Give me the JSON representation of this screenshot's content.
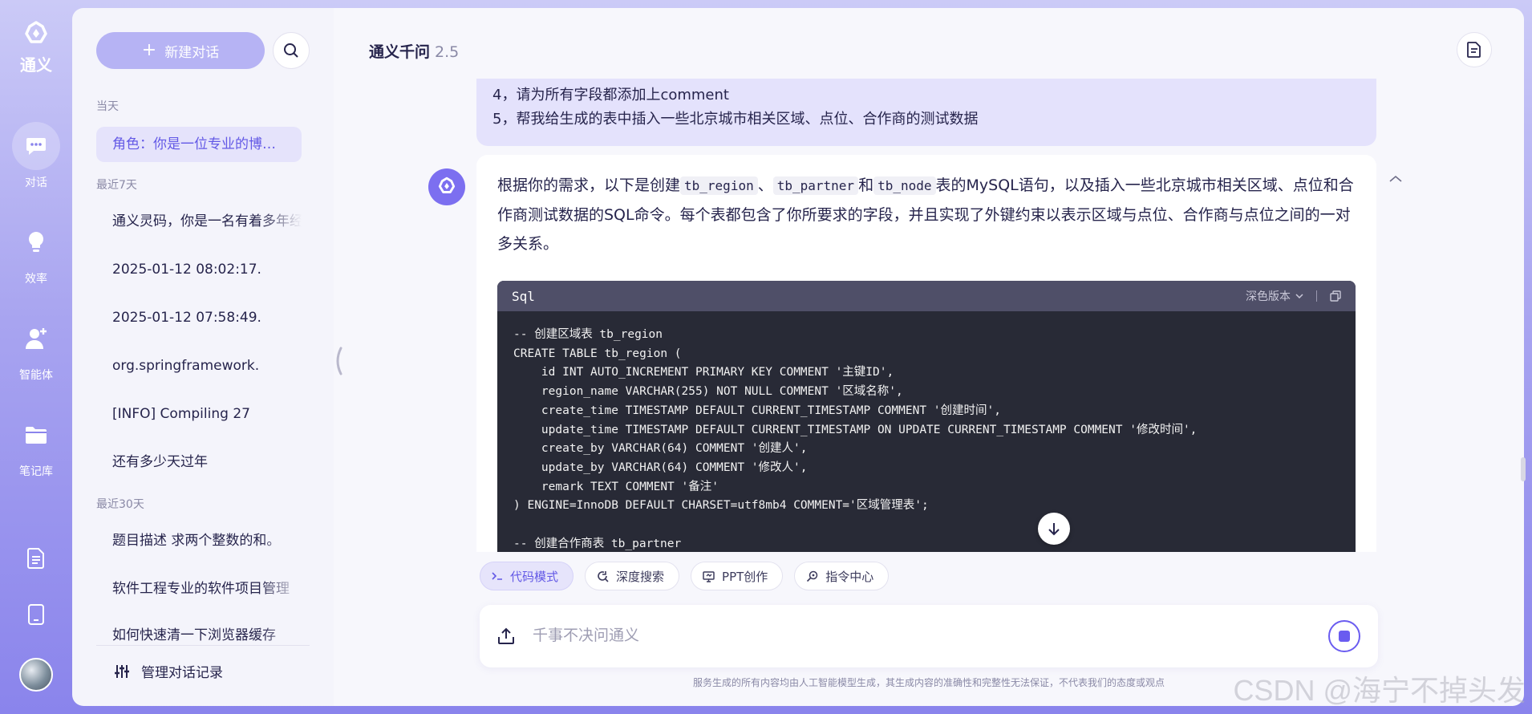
{
  "app": {
    "name": "通义"
  },
  "rail": {
    "items": [
      {
        "label": "对话",
        "icon": "chat-icon",
        "active": true
      },
      {
        "label": "效率",
        "icon": "lightbulb-icon"
      },
      {
        "label": "智能体",
        "icon": "agent-icon"
      },
      {
        "label": "笔记库",
        "icon": "folder-icon"
      }
    ]
  },
  "sidebar": {
    "new_chat_label": "新建对话",
    "sections": {
      "today": "当天",
      "week": "最近7天",
      "month": "最近30天"
    },
    "today_items": [
      "角色：你是一位专业的博客技术专家"
    ],
    "week_items": [
      "通义灵码，你是一名有着多年经验",
      "2025-01-12 08:02:17.",
      "2025-01-12 07:58:49.",
      "org.springframework.",
      "[INFO] Compiling 27",
      "还有多少天过年"
    ],
    "month_items": [
      "题目描述 求两个整数的和。",
      "软件工程专业的软件项目管理",
      "如何快速清一下浏览器缓存"
    ],
    "manage_label": "管理对话记录"
  },
  "header": {
    "title": "通义千问",
    "version": "2.5"
  },
  "user_message": {
    "lines": [
      "4，请为所有字段都添加上comment",
      "5，帮我给生成的表中插入一些北京城市相关区域、点位、合作商的测试数据"
    ]
  },
  "bot_message": {
    "p1": "根据你的需求，以下是创建",
    "code1": "tb_region",
    "p2": "、",
    "code2": "tb_partner",
    "p3": "和",
    "code3": "tb_node",
    "p4": "表的MySQL语句，以及插入一些北京城市相关区域、点位和合作商测试数据的SQL命令。每个表都包含了你所要求的字段，并且实现了外键约束以表示区域与点位、合作商与点位之间的一对多关系。"
  },
  "code_block": {
    "language": "Sql",
    "theme_label": "深色版本",
    "lines": [
      "-- 创建区域表 tb_region",
      "CREATE TABLE tb_region (",
      "    id INT AUTO_INCREMENT PRIMARY KEY COMMENT '主键ID',",
      "    region_name VARCHAR(255) NOT NULL COMMENT '区域名称',",
      "    create_time TIMESTAMP DEFAULT CURRENT_TIMESTAMP COMMENT '创建时间',",
      "    update_time TIMESTAMP DEFAULT CURRENT_TIMESTAMP ON UPDATE CURRENT_TIMESTAMP COMMENT '修改时间',",
      "    create_by VARCHAR(64) COMMENT '创建人',",
      "    update_by VARCHAR(64) COMMENT '修改人',",
      "    remark TEXT COMMENT '备注'",
      ") ENGINE=InnoDB DEFAULT CHARSET=utf8mb4 COMMENT='区域管理表';",
      "",
      "-- 创建合作商表 tb_partner"
    ]
  },
  "chips": [
    {
      "label": "代码模式",
      "icon": "terminal-icon",
      "active": true
    },
    {
      "label": "深度搜索",
      "icon": "deep-search-icon"
    },
    {
      "label": "PPT创作",
      "icon": "ppt-icon"
    },
    {
      "label": "指令中心",
      "icon": "command-icon"
    }
  ],
  "input": {
    "placeholder": "千事不决问通义"
  },
  "disclaimer": "服务生成的所有内容均由人工智能模型生成，其生成内容的准确性和完整性无法保证，不代表我们的态度或观点",
  "watermark": "CSDN @海宁不掉头发",
  "colors": {
    "accent": "#6359e6",
    "rail": "#8a84ec",
    "code_bg": "#282a36"
  }
}
